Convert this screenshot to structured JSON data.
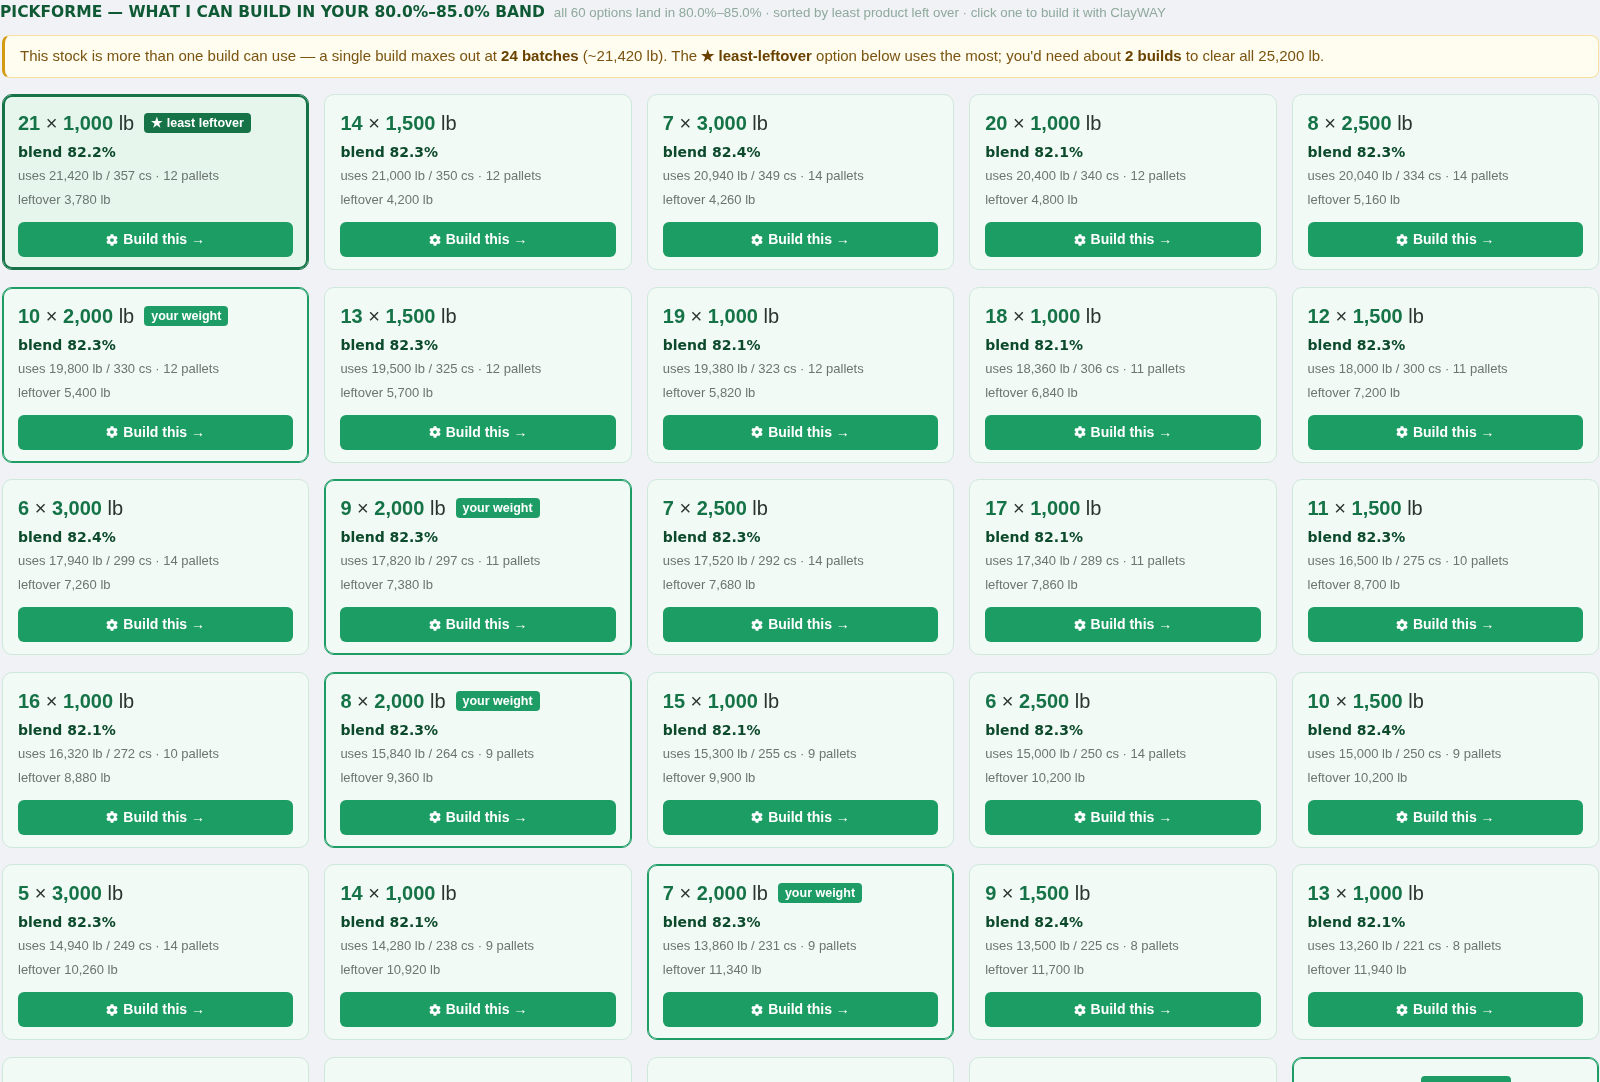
{
  "header": {
    "title": "PICKFORME — WHAT I CAN BUILD IN YOUR 80.0%–85.0% BAND",
    "subtitle": "all 60 options land in 80.0%–85.0% · sorted by least product left over · click one to build it with ClayWAY"
  },
  "notice": "This stock is more than one build can use — a single build maxes out at **24 batches** (~21,420 lb). The **★ least-leftover** option below uses the most; you'd need about **2 builds** to clear all 25,200 lb.",
  "options": [
    {
      "kind": "least",
      "title": "**21** × **1,000** lb",
      "badge": "★ least leftover",
      "blend": "blend 82.2%",
      "uses": "uses 21,420 lb / 357 cs · 12 pallets",
      "leftover": "leftover 3,780 lb",
      "button": "Build this →"
    },
    {
      "kind": "plain",
      "title": "**14** × **1,500** lb",
      "blend": "blend 82.3%",
      "uses": "uses 21,000 lb / 350 cs · 12 pallets",
      "leftover": "leftover 4,200 lb",
      "button": "Build this →"
    },
    {
      "kind": "plain",
      "title": "**7** × **3,000** lb",
      "blend": "blend 82.4%",
      "uses": "uses 20,940 lb / 349 cs · 14 pallets",
      "leftover": "leftover 4,260 lb",
      "button": "Build this →"
    },
    {
      "kind": "plain",
      "title": "**20** × **1,000** lb",
      "blend": "blend 82.1%",
      "uses": "uses 20,400 lb / 340 cs · 12 pallets",
      "leftover": "leftover 4,800 lb",
      "button": "Build this →"
    },
    {
      "kind": "plain",
      "title": "**8** × **2,500** lb",
      "blend": "blend 82.3%",
      "uses": "uses 20,040 lb / 334 cs · 14 pallets",
      "leftover": "leftover 5,160 lb",
      "button": "Build this →"
    },
    {
      "kind": "weight",
      "title": "**10** × **2,000** lb",
      "badge": "your weight",
      "blend": "blend 82.3%",
      "uses": "uses 19,800 lb / 330 cs · 12 pallets",
      "leftover": "leftover 5,400 lb",
      "button": "Build this →"
    },
    {
      "kind": "plain",
      "title": "**13** × **1,500** lb",
      "blend": "blend 82.3%",
      "uses": "uses 19,500 lb / 325 cs · 12 pallets",
      "leftover": "leftover 5,700 lb",
      "button": "Build this →"
    },
    {
      "kind": "plain",
      "title": "**19** × **1,000** lb",
      "blend": "blend 82.1%",
      "uses": "uses 19,380 lb / 323 cs · 12 pallets",
      "leftover": "leftover 5,820 lb",
      "button": "Build this →"
    },
    {
      "kind": "plain",
      "title": "**18** × **1,000** lb",
      "blend": "blend 82.1%",
      "uses": "uses 18,360 lb / 306 cs · 11 pallets",
      "leftover": "leftover 6,840 lb",
      "button": "Build this →"
    },
    {
      "kind": "plain",
      "title": "**12** × **1,500** lb",
      "blend": "blend 82.3%",
      "uses": "uses 18,000 lb / 300 cs · 11 pallets",
      "leftover": "leftover 7,200 lb",
      "button": "Build this →"
    },
    {
      "kind": "plain",
      "title": "**6** × **3,000** lb",
      "blend": "blend 82.4%",
      "uses": "uses 17,940 lb / 299 cs · 14 pallets",
      "leftover": "leftover 7,260 lb",
      "button": "Build this →"
    },
    {
      "kind": "weight",
      "title": "**9** × **2,000** lb",
      "badge": "your weight",
      "blend": "blend 82.3%",
      "uses": "uses 17,820 lb / 297 cs · 11 pallets",
      "leftover": "leftover 7,380 lb",
      "button": "Build this →"
    },
    {
      "kind": "plain",
      "title": "**7** × **2,500** lb",
      "blend": "blend 82.3%",
      "uses": "uses 17,520 lb / 292 cs · 14 pallets",
      "leftover": "leftover 7,680 lb",
      "button": "Build this →"
    },
    {
      "kind": "plain",
      "title": "**17** × **1,000** lb",
      "blend": "blend 82.1%",
      "uses": "uses 17,340 lb / 289 cs · 11 pallets",
      "leftover": "leftover 7,860 lb",
      "button": "Build this →"
    },
    {
      "kind": "plain",
      "title": "**11** × **1,500** lb",
      "blend": "blend 82.3%",
      "uses": "uses 16,500 lb / 275 cs · 10 pallets",
      "leftover": "leftover 8,700 lb",
      "button": "Build this →"
    },
    {
      "kind": "plain",
      "title": "**16** × **1,000** lb",
      "blend": "blend 82.1%",
      "uses": "uses 16,320 lb / 272 cs · 10 pallets",
      "leftover": "leftover 8,880 lb",
      "button": "Build this →"
    },
    {
      "kind": "weight",
      "title": "**8** × **2,000** lb",
      "badge": "your weight",
      "blend": "blend 82.3%",
      "uses": "uses 15,840 lb / 264 cs · 9 pallets",
      "leftover": "leftover 9,360 lb",
      "button": "Build this →"
    },
    {
      "kind": "plain",
      "title": "**15** × **1,000** lb",
      "blend": "blend 82.1%",
      "uses": "uses 15,300 lb / 255 cs · 9 pallets",
      "leftover": "leftover 9,900 lb",
      "button": "Build this →"
    },
    {
      "kind": "plain",
      "title": "**6** × **2,500** lb",
      "blend": "blend 82.3%",
      "uses": "uses 15,000 lb / 250 cs · 14 pallets",
      "leftover": "leftover 10,200 lb",
      "button": "Build this →"
    },
    {
      "kind": "plain",
      "title": "**10** × **1,500** lb",
      "blend": "blend 82.4%",
      "uses": "uses 15,000 lb / 250 cs · 9 pallets",
      "leftover": "leftover 10,200 lb",
      "button": "Build this →"
    },
    {
      "kind": "plain",
      "title": "**5** × **3,000** lb",
      "blend": "blend 82.3%",
      "uses": "uses 14,940 lb / 249 cs · 14 pallets",
      "leftover": "leftover 10,260 lb",
      "button": "Build this →"
    },
    {
      "kind": "plain",
      "title": "**14** × **1,000** lb",
      "blend": "blend 82.1%",
      "uses": "uses 14,280 lb / 238 cs · 9 pallets",
      "leftover": "leftover 10,920 lb",
      "button": "Build this →"
    },
    {
      "kind": "weight",
      "title": "**7** × **2,000** lb",
      "badge": "your weight",
      "blend": "blend 82.3%",
      "uses": "uses 13,860 lb / 231 cs · 9 pallets",
      "leftover": "leftover 11,340 lb",
      "button": "Build this →"
    },
    {
      "kind": "plain",
      "title": "**9** × **1,500** lb",
      "blend": "blend 82.4%",
      "uses": "uses 13,500 lb / 225 cs · 8 pallets",
      "leftover": "leftover 11,700 lb",
      "button": "Build this →"
    },
    {
      "kind": "plain",
      "title": "**13** × **1,000** lb",
      "blend": "blend 82.1%",
      "uses": "uses 13,260 lb / 221 cs · 8 pallets",
      "leftover": "leftover 11,940 lb",
      "button": "Build this →"
    }
  ],
  "cut_off_options": [
    {
      "kind": "plain"
    },
    {
      "kind": "plain"
    },
    {
      "kind": "plain"
    },
    {
      "kind": "plain"
    },
    {
      "kind": "weight"
    }
  ]
}
